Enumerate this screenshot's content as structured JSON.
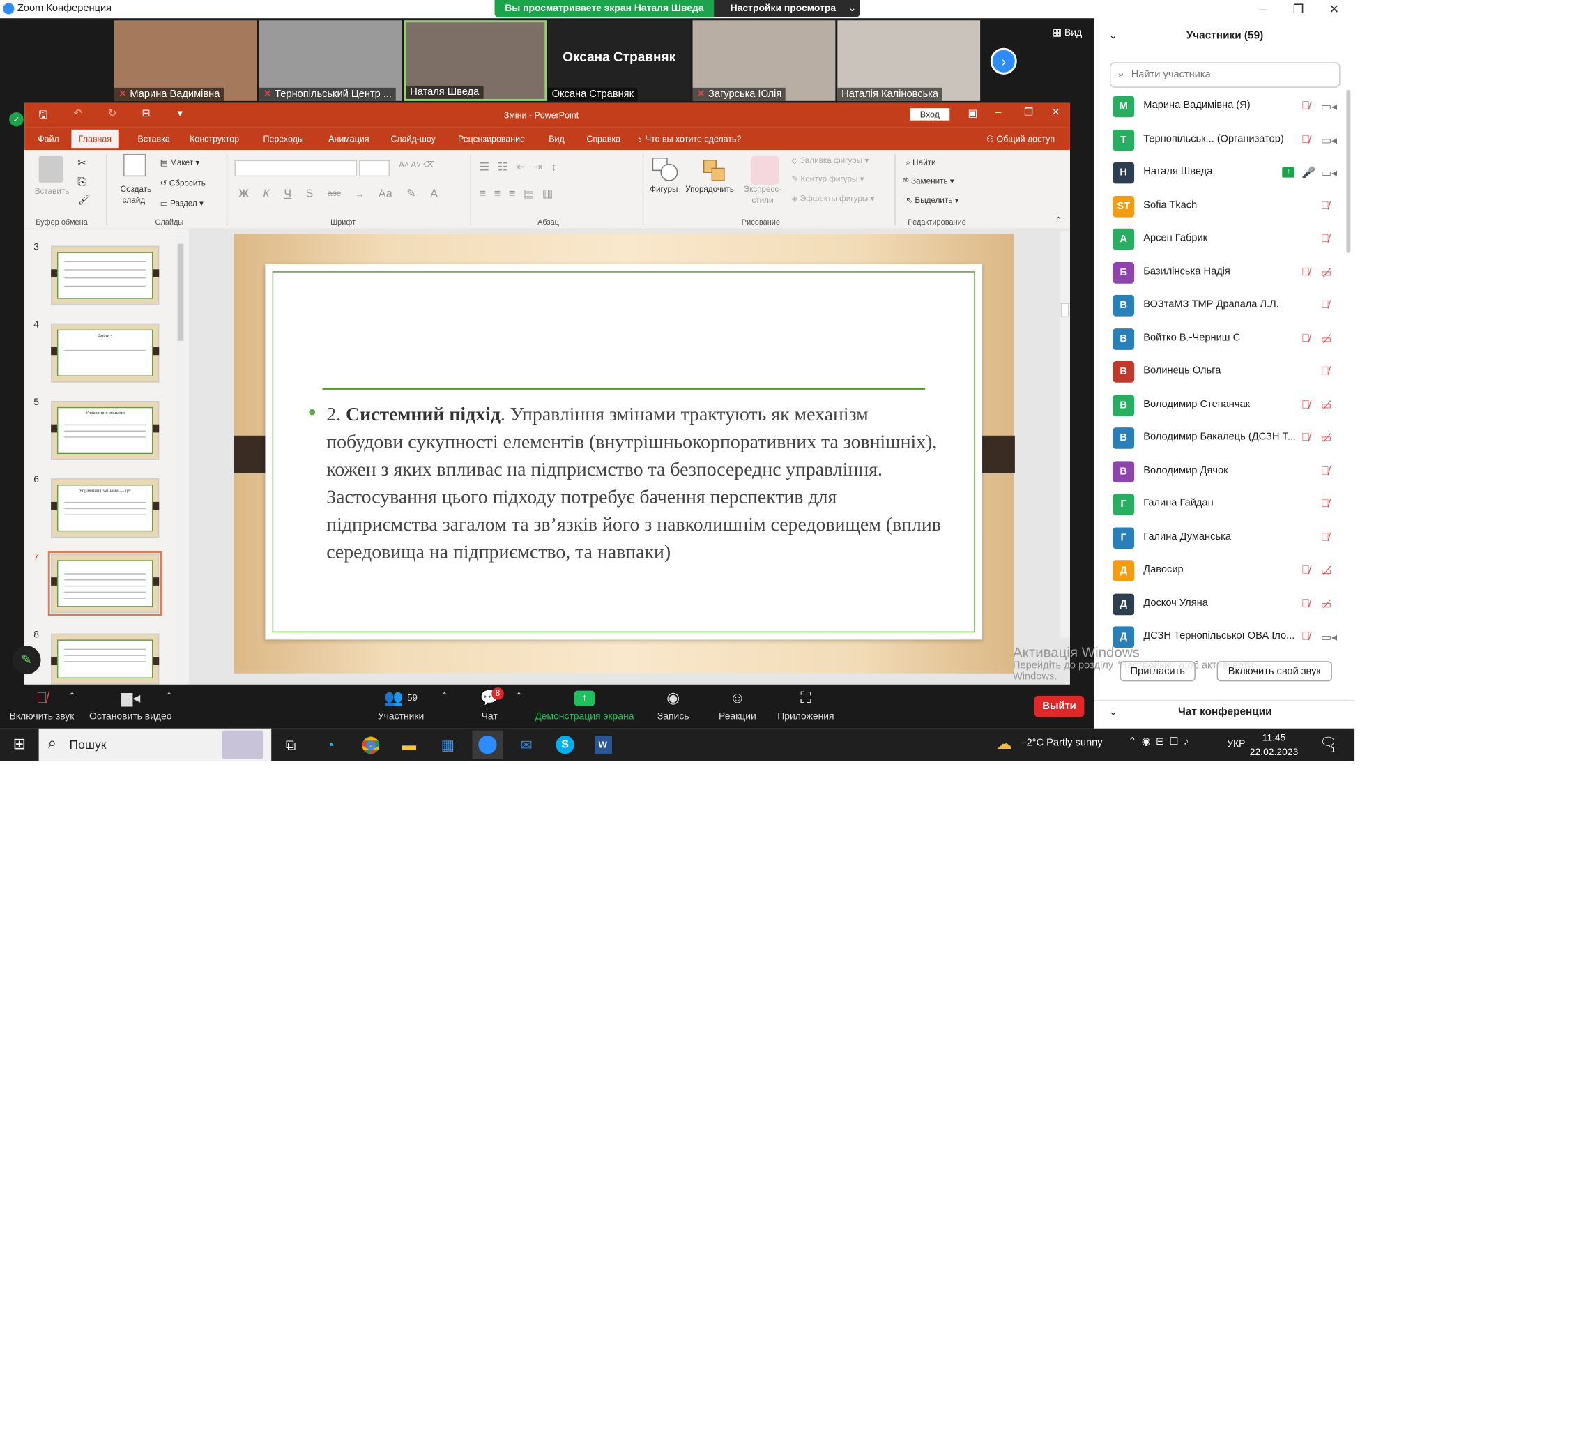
{
  "zoom": {
    "window_title": "Zoom Конференция",
    "share_banner": "Вы просматриваете экран Наталя Шведа",
    "view_options": "Настройки просмотра",
    "view_label": "Вид",
    "featured_name": "Оксана Стравняк",
    "tiles": [
      {
        "name": "Марина Вадимівна",
        "muted": true,
        "bg": "#a57a5c"
      },
      {
        "name": "Тернопільський Центр ...",
        "muted": true,
        "bg": "#9a9a9a"
      },
      {
        "name": "Наталя Шведа",
        "muted": false,
        "bg": "#7d6f65"
      },
      {
        "name": "Оксана Стравняк",
        "muted": false,
        "bg": "#222222"
      },
      {
        "name": "Загурська Юлія",
        "muted": true,
        "bg": "#b8aea3"
      },
      {
        "name": "Наталія Каліновська",
        "muted": false,
        "bg": "#c9c3bb"
      }
    ],
    "toolbar": {
      "unmute": "Включить звук",
      "stop_video": "Остановить видео",
      "participants": "Участники",
      "participants_count": "59",
      "chat": "Чат",
      "chat_badge": "8",
      "share": "Демонстрация экрана",
      "record": "Запись",
      "reactions": "Реакции",
      "apps": "Приложения",
      "leave": "Выйти"
    }
  },
  "ppt": {
    "title": "Зміни  -  PowerPoint",
    "login": "Вход",
    "tabs": [
      "Файл",
      "Главная",
      "Вставка",
      "Конструктор",
      "Переходы",
      "Анимация",
      "Слайд-шоу",
      "Рецензирование",
      "Вид",
      "Справка"
    ],
    "tell_me": "Что вы хотите сделать?",
    "share": "Общий доступ",
    "ribbon": {
      "paste": "Вставить",
      "clipboard": "Буфер обмена",
      "new_slide_1": "Создать",
      "new_slide_2": "слайд",
      "layout": "Макет",
      "reset": "Сбросить",
      "section": "Раздел",
      "slides": "Слайды",
      "font": "Шрифт",
      "paragraph": "Абзац",
      "shapes": "Фигуры",
      "arrange": "Упорядочить",
      "quick_styles_1": "Экспресс-",
      "quick_styles_2": "стили",
      "shape_fill": "Заливка фигуры",
      "shape_outline": "Контур фигуры",
      "shape_effects": "Эффекты фигуры",
      "drawing": "Рисование",
      "find": "Найти",
      "replace": "Заменить",
      "select": "Выделить",
      "editing": "Редактирование",
      "font_buttons": [
        "Ж",
        "К",
        "Ч",
        "S",
        "abc",
        "Аа"
      ]
    },
    "thumbs": [
      {
        "num": "3",
        "title": ""
      },
      {
        "num": "4",
        "title": "Зміни -"
      },
      {
        "num": "5",
        "title": "Управління змінами"
      },
      {
        "num": "6",
        "title": "Управління змінами — це:"
      },
      {
        "num": "7",
        "title": ""
      },
      {
        "num": "8",
        "title": ""
      }
    ],
    "slide": {
      "num": "2.",
      "bold": "Системний підхід",
      "text": ". Управління змінами трактують як механізм побудови сукупності елементів (внутрішньокорпоративних та зовнішніх), кожен з яких впливає на підприємство та безпосереднє управління. Застосування цього підходу потребує бачення перспектив для підприємства загалом та зв’язків його з навколишнім середовищем (вплив середовища на підприємство, та навпаки)"
    }
  },
  "participants": {
    "header": "Участники (59)",
    "search_placeholder": "Найти участника",
    "list": [
      {
        "initial": "М",
        "name": "Марина Вадимівна (Я)",
        "color": "#27ae60",
        "mic": "muted",
        "cam": "on"
      },
      {
        "initial": "Т",
        "name": "Тернопільськ...  (Организатор)",
        "color": "#27ae60",
        "mic": "muted",
        "cam": "on"
      },
      {
        "initial": "Н",
        "name": "Наталя Шведа",
        "color": "#2c3e50",
        "mic": "on",
        "cam": "on"
      },
      {
        "initial": "ST",
        "name": "Sofia Tkach",
        "color": "#f39c12",
        "mic": "muted",
        "cam": "none"
      },
      {
        "initial": "А",
        "name": "Арсен Габрик",
        "color": "#27ae60",
        "mic": "muted",
        "cam": "none"
      },
      {
        "initial": "Б",
        "name": "Базилінська Надія",
        "color": "#8e44ad",
        "mic": "muted",
        "cam": "off"
      },
      {
        "initial": "В",
        "name": "ВОЗтаМЗ ТМР Драпала Л.Л.",
        "color": "#2980b9",
        "mic": "muted",
        "cam": "none"
      },
      {
        "initial": "В",
        "name": "Войтко В.-Черниш С",
        "color": "#2980b9",
        "mic": "muted",
        "cam": "off"
      },
      {
        "initial": "В",
        "name": "Волинець Ольга",
        "color": "#c0392b",
        "mic": "muted",
        "cam": "none"
      },
      {
        "initial": "В",
        "name": "Володимир Степанчак",
        "color": "#27ae60",
        "mic": "muted",
        "cam": "off"
      },
      {
        "initial": "В",
        "name": "Володимир Бакалець (ДСЗН Т...",
        "color": "#2980b9",
        "mic": "muted",
        "cam": "off"
      },
      {
        "initial": "В",
        "name": "Володимир Дячок",
        "color": "#8e44ad",
        "mic": "muted",
        "cam": "none"
      },
      {
        "initial": "Г",
        "name": "Галина Гайдан",
        "color": "#27ae60",
        "mic": "muted",
        "cam": "none"
      },
      {
        "initial": "Г",
        "name": "Галина Думанська",
        "color": "#2980b9",
        "mic": "muted",
        "cam": "none"
      },
      {
        "initial": "Д",
        "name": "Давосир",
        "color": "#f39c12",
        "mic": "muted",
        "cam": "off"
      },
      {
        "initial": "Д",
        "name": "Доскоч Уляна",
        "color": "#2c3e50",
        "mic": "muted",
        "cam": "off"
      },
      {
        "initial": "Д",
        "name": "ДСЗН Тернопільської ОВА Іло...",
        "color": "#2980b9",
        "mic": "muted",
        "cam": "on"
      }
    ],
    "invite": "Пригласить",
    "unmute_me": "Включить свой звук",
    "chat_header": "Чат конференции"
  },
  "activation": {
    "title": "Активація Windows",
    "line1": "Перейдіть до розділу \"Настройки\", щоб активувати",
    "line2": "Windows."
  },
  "taskbar": {
    "search": "Пошук",
    "weather": "-2°C  Partly sunny",
    "lang": "УКР",
    "time": "11:45",
    "date": "22.02.2023",
    "notifications": "1"
  }
}
